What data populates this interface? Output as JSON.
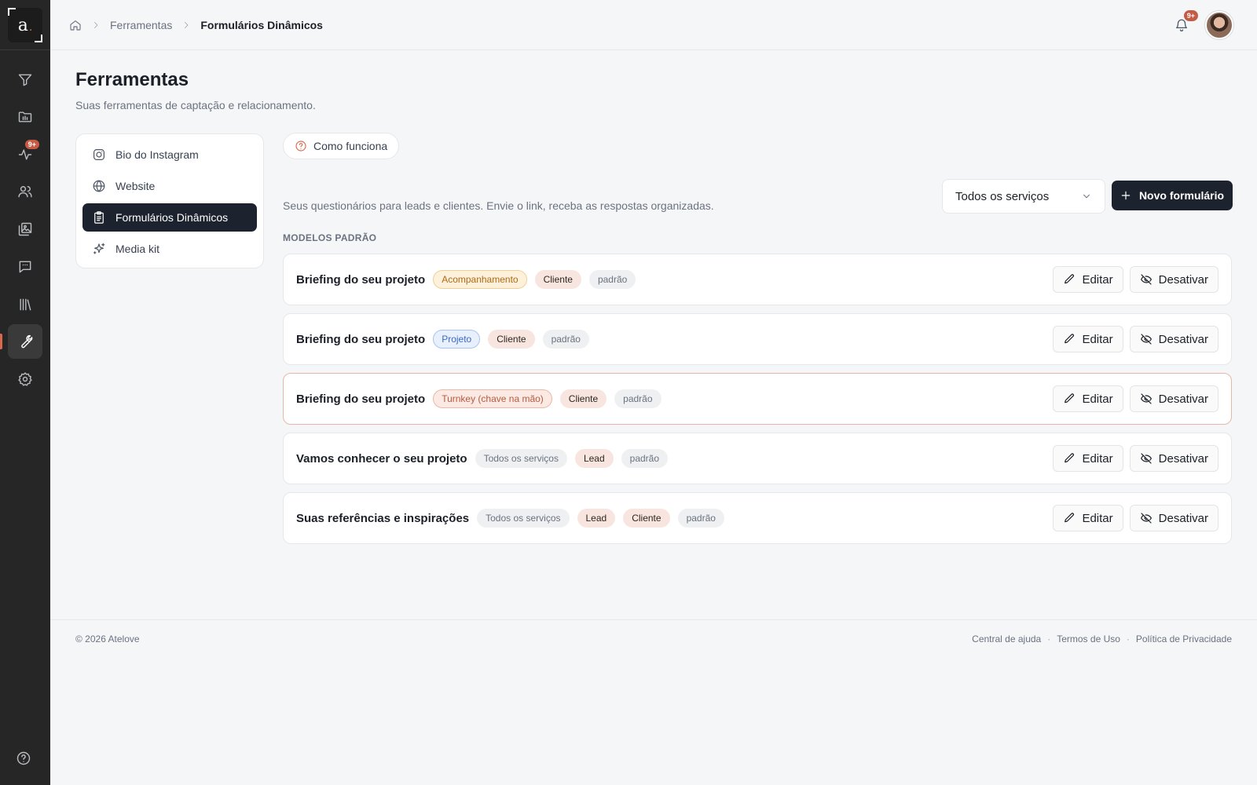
{
  "app": {
    "logo_letter": "a",
    "logo_dot": "."
  },
  "rail": {
    "badge": "9+",
    "icons": [
      "filter-icon",
      "folder-icon",
      "activity-icon",
      "users-icon",
      "gallery-icon",
      "messages-icon",
      "library-icon",
      "tools-icon",
      "settings-icon"
    ],
    "active": "tools-icon",
    "help": "help-icon"
  },
  "breadcrumb": {
    "items": [
      "Ferramentas",
      "Formulários Dinâmicos"
    ]
  },
  "header": {
    "notifications_badge": "9+"
  },
  "page": {
    "title": "Ferramentas",
    "subtitle": "Suas ferramentas de captação e relacionamento."
  },
  "side_menu": {
    "items": [
      {
        "label": "Bio do Instagram",
        "icon": "instagram-icon"
      },
      {
        "label": "Website",
        "icon": "globe-icon"
      },
      {
        "label": "Formulários Dinâmicos",
        "icon": "clipboard-icon",
        "active": true
      },
      {
        "label": "Media kit",
        "icon": "sparkles-icon"
      }
    ]
  },
  "main": {
    "how_it_works": "Como funciona",
    "description": "Seus questionários para leads e clientes. Envie o link, receba as respostas organizadas.",
    "filter_select": "Todos os serviços",
    "new_button": "Novo formulário",
    "section_title": "MODELOS PADRÃO",
    "edit_label": "Editar",
    "disable_label": "Desativar",
    "forms": [
      {
        "title": "Briefing do seu projeto",
        "tags": [
          {
            "label": "Acompanhamento",
            "style": "amber"
          },
          {
            "label": "Cliente",
            "style": "peach"
          },
          {
            "label": "padrão",
            "style": "grey"
          }
        ]
      },
      {
        "title": "Briefing do seu projeto",
        "tags": [
          {
            "label": "Projeto",
            "style": "blue"
          },
          {
            "label": "Cliente",
            "style": "peach"
          },
          {
            "label": "padrão",
            "style": "grey"
          }
        ]
      },
      {
        "title": "Briefing do seu projeto",
        "highlighted": true,
        "tags": [
          {
            "label": "Turnkey (chave na mão)",
            "style": "orange"
          },
          {
            "label": "Cliente",
            "style": "peach"
          },
          {
            "label": "padrão",
            "style": "grey"
          }
        ]
      },
      {
        "title": "Vamos conhecer o seu projeto",
        "tags": [
          {
            "label": "Todos os serviços",
            "style": "grey"
          },
          {
            "label": "Lead",
            "style": "peach"
          },
          {
            "label": "padrão",
            "style": "grey"
          }
        ]
      },
      {
        "title": "Suas referências e inspirações",
        "tags": [
          {
            "label": "Todos os serviços",
            "style": "grey"
          },
          {
            "label": "Lead",
            "style": "peach"
          },
          {
            "label": "Cliente",
            "style": "peach"
          },
          {
            "label": "padrão",
            "style": "grey"
          }
        ]
      }
    ]
  },
  "footer": {
    "copyright": "© 2026 Atelove",
    "links": [
      "Central de ajuda",
      "Termos de Uso",
      "Política de Privacidade"
    ],
    "separator": "·"
  },
  "colors": {
    "accent": "#d9694c",
    "dark": "#1d232e",
    "rail": "#262626",
    "background": "#f5f6f8"
  }
}
